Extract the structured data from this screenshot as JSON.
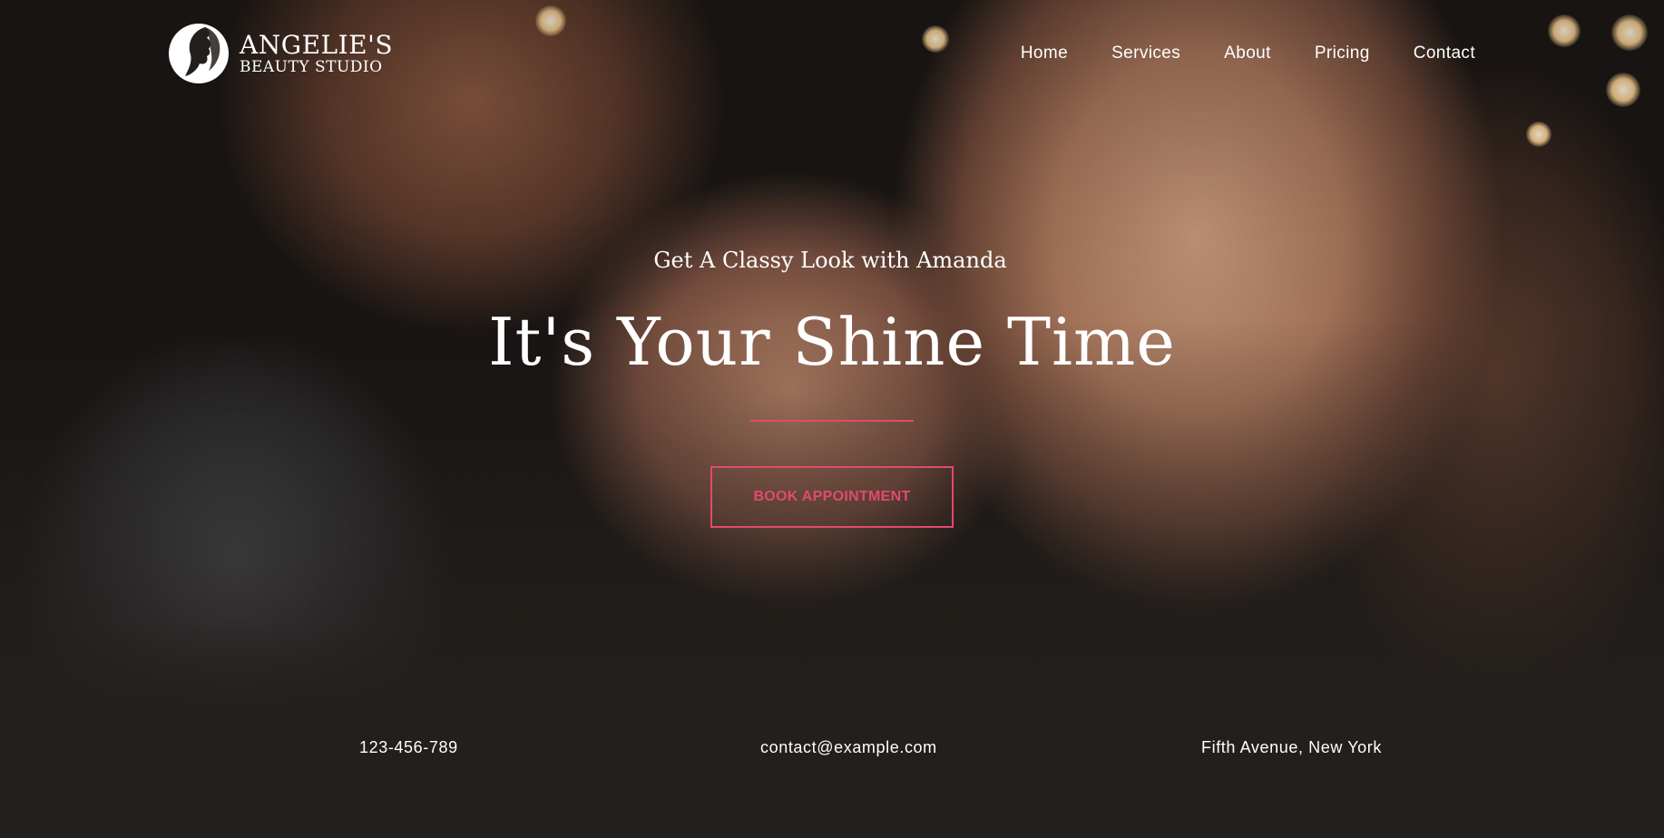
{
  "brand": {
    "name": "ANGELIE'S",
    "tagline": "BEAUTY STUDIO",
    "logo_icon": "woman-silhouette-icon"
  },
  "nav": {
    "items": [
      {
        "label": "Home"
      },
      {
        "label": "Services"
      },
      {
        "label": "About"
      },
      {
        "label": "Pricing"
      },
      {
        "label": "Contact"
      }
    ]
  },
  "hero": {
    "kicker": "Get A Classy Look with Amanda",
    "headline": "It's Your Shine Time",
    "cta_label": "BOOK APPOINTMENT",
    "accent_color": "#e04a6e"
  },
  "contact": {
    "phone": "123-456-789",
    "email": "contact@example.com",
    "address": "Fifth Avenue, New York"
  }
}
